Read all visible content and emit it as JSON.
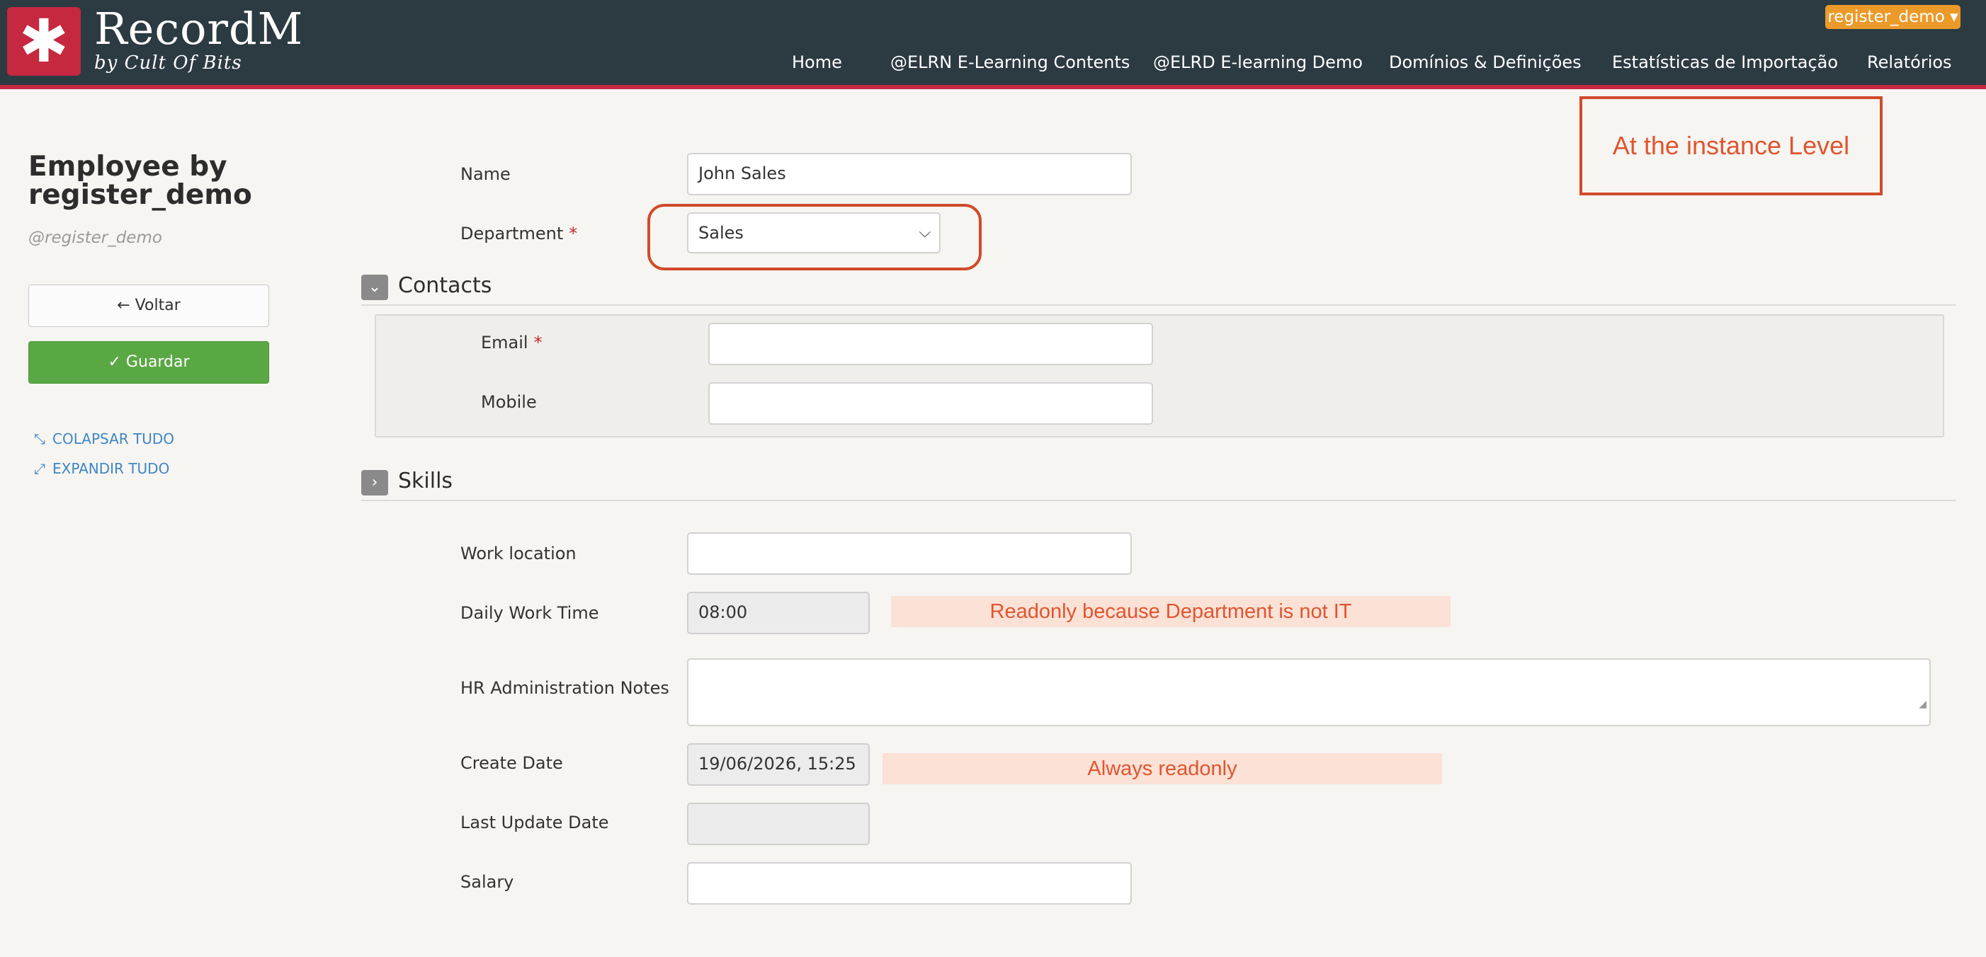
{
  "app": {
    "logo_glyph": "✱",
    "brand": "RecordM",
    "brand_sub": "by Cult Of Bits",
    "user_menu": "register_demo ▾"
  },
  "nav": {
    "items": [
      {
        "label": "Home"
      },
      {
        "label": "@ELRN E-Learning Contents"
      },
      {
        "label": "@ELRD E-learning Demo"
      },
      {
        "label": "Domínios & Definições"
      },
      {
        "label": "Estatísticas de Importação"
      },
      {
        "label": "Relatórios"
      }
    ]
  },
  "sidebar": {
    "title_line1": "Employee by",
    "title_line2": "register_demo",
    "subtitle": "@register_demo",
    "back_label": "← Voltar",
    "save_label": "✓ Guardar",
    "collapse_label": "COLAPSAR TUDO",
    "expand_label": "EXPANDIR TUDO"
  },
  "form": {
    "name": {
      "label": "Name",
      "value": "John Sales"
    },
    "department": {
      "label": "Department",
      "required_mark": "*",
      "value": "Sales"
    },
    "contacts": {
      "title": "Contacts",
      "email": {
        "label": "Email",
        "required_mark": "*",
        "value": ""
      },
      "mobile": {
        "label": "Mobile",
        "value": ""
      }
    },
    "skills": {
      "title": "Skills"
    },
    "work_location": {
      "label": "Work location",
      "value": ""
    },
    "daily_work_time": {
      "label": "Daily Work Time",
      "value": "08:00"
    },
    "hr_notes": {
      "label": "HR Administration Notes",
      "value": ""
    },
    "create_date": {
      "label": "Create Date",
      "value": "19/06/2026, 15:25"
    },
    "last_update_date": {
      "label": "Last Update Date",
      "value": ""
    },
    "salary": {
      "label": "Salary",
      "value": ""
    }
  },
  "annotations": {
    "instance_level": "At the instance Level",
    "readonly_department": "Readonly because Department is not IT",
    "always_readonly": "Always readonly"
  },
  "colors": {
    "topbar": "#2c3a42",
    "brand_red": "#c5283f",
    "save_green": "#5aa844",
    "user_menu_orange": "#eb9a2a",
    "annotation_red": "#d24a2a"
  }
}
